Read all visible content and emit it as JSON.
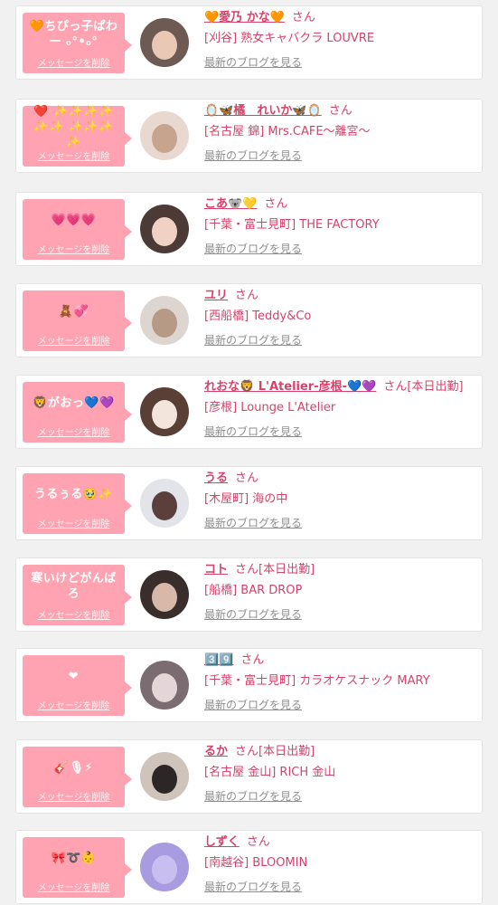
{
  "accent_color": "#d6426a",
  "bubble_color": "#ffa3b2",
  "delete_label": "メッセージを削除",
  "blog_label": "最新のブログを見る",
  "san_label": "さん",
  "cards": [
    {
      "message": "🧡ちぴっ子ぱわー ₀°•₀°",
      "name": "🧡愛乃 かな🧡",
      "status": "",
      "shop": "[刈谷] 熟女キャバクラ LOUVRE",
      "avatar_bg": "#6d5a52",
      "avatar_fg": "#e9c9b6"
    },
    {
      "message": "❤️ ✨✨✨✨✨✨ ✨✨✨✨",
      "name": "🪞🦋橘　れいか🦋🪞",
      "status": "",
      "shop": "[名古屋 錦] Mrs.CAFE〜離宮〜",
      "avatar_bg": "#e8d8d0",
      "avatar_fg": "#c7a48e"
    },
    {
      "message": "💗💗💗",
      "name": "こあ🐨💛",
      "status": "",
      "shop": "[千葉・富士見町] THE FACTORY",
      "avatar_bg": "#4c3a36",
      "avatar_fg": "#efd2c4"
    },
    {
      "message": "🧸💞",
      "name": "ユリ",
      "status": "",
      "shop": "[西船橋] Teddy&Co",
      "avatar_bg": "#ddd5cf",
      "avatar_fg": "#b69a86"
    },
    {
      "message": "🦁がおっ💙💜",
      "name": "れおな🦁 L'Atelier-彦根-💙💜",
      "status": "[本日出勤]",
      "shop": "[彦根] Lounge L'Atelier",
      "avatar_bg": "#5a3f36",
      "avatar_fg": "#f3e4dc"
    },
    {
      "message": "うるぅる🥹✨",
      "name": "うる",
      "status": "",
      "shop": "[木屋町] 海の中",
      "avatar_bg": "#e2e4ea",
      "avatar_fg": "#5a3f3a"
    },
    {
      "message": "寒いけどがんばろ",
      "name": "コト",
      "status": "[本日出勤]",
      "shop": "[船橋] BAR DROP",
      "avatar_bg": "#3a2e2c",
      "avatar_fg": "#d8b8a8"
    },
    {
      "message": "❤",
      "name": "3️⃣9️⃣",
      "status": "",
      "shop": "[千葉・富士見町] カラオケスナック MARY",
      "avatar_bg": "#7a6c70",
      "avatar_fg": "#e4d5d8"
    },
    {
      "message": "🎸🎙⚡",
      "name": "るか",
      "status": "[本日出勤]",
      "shop": "[名古屋 金山] RICH 金山",
      "avatar_bg": "#cfc4bb",
      "avatar_fg": "#2c2626"
    },
    {
      "message": "🎀➰👶",
      "name": "しずく",
      "status": "",
      "shop": "[南越谷] BLOOMIN",
      "avatar_bg": "#a89be0",
      "avatar_fg": "#c8bef0"
    }
  ]
}
